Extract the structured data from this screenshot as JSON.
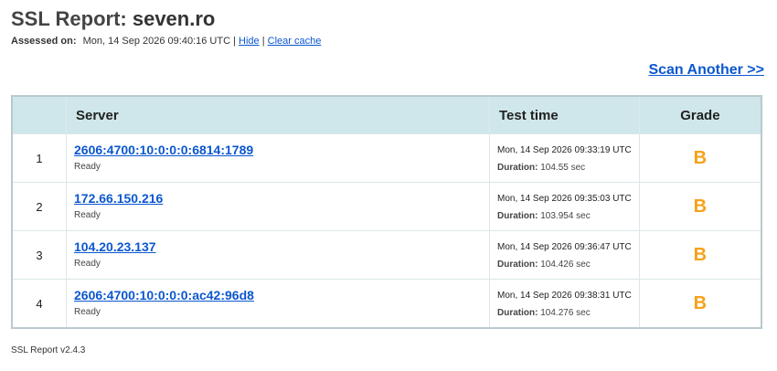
{
  "header": {
    "title_prefix": "SSL Report:",
    "host": "seven.ro",
    "assessed_label": "Assessed on:",
    "assessed_value": "Mon, 14 Sep 2026 09:40:16 UTC",
    "separator": "|",
    "hide_label": "Hide",
    "clear_cache_label": "Clear cache",
    "scan_another_label": "Scan Another >>"
  },
  "table": {
    "columns": [
      "",
      "Server",
      "Test time",
      "Grade"
    ],
    "duration_label": "Duration:",
    "rows": [
      {
        "num": "1",
        "server": "2606:4700:10:0:0:0:6814:1789",
        "status": "Ready",
        "test_time": "Mon, 14 Sep 2026 09:33:19 UTC",
        "duration": "104.55 sec",
        "grade": "B"
      },
      {
        "num": "2",
        "server": "172.66.150.216",
        "status": "Ready",
        "test_time": "Mon, 14 Sep 2026 09:35:03 UTC",
        "duration": "103.954 sec",
        "grade": "B"
      },
      {
        "num": "3",
        "server": "104.20.23.137",
        "status": "Ready",
        "test_time": "Mon, 14 Sep 2026 09:36:47 UTC",
        "duration": "104.426 sec",
        "grade": "B"
      },
      {
        "num": "4",
        "server": "2606:4700:10:0:0:0:ac42:96d8",
        "status": "Ready",
        "test_time": "Mon, 14 Sep 2026 09:38:31 UTC",
        "duration": "104.276 sec",
        "grade": "B"
      }
    ]
  },
  "footer": {
    "version": "SSL Report v2.4.3"
  },
  "colors": {
    "header_bg": "#cfe7ea",
    "link": "#0b57d0",
    "grade_b": "#f7a11a"
  }
}
